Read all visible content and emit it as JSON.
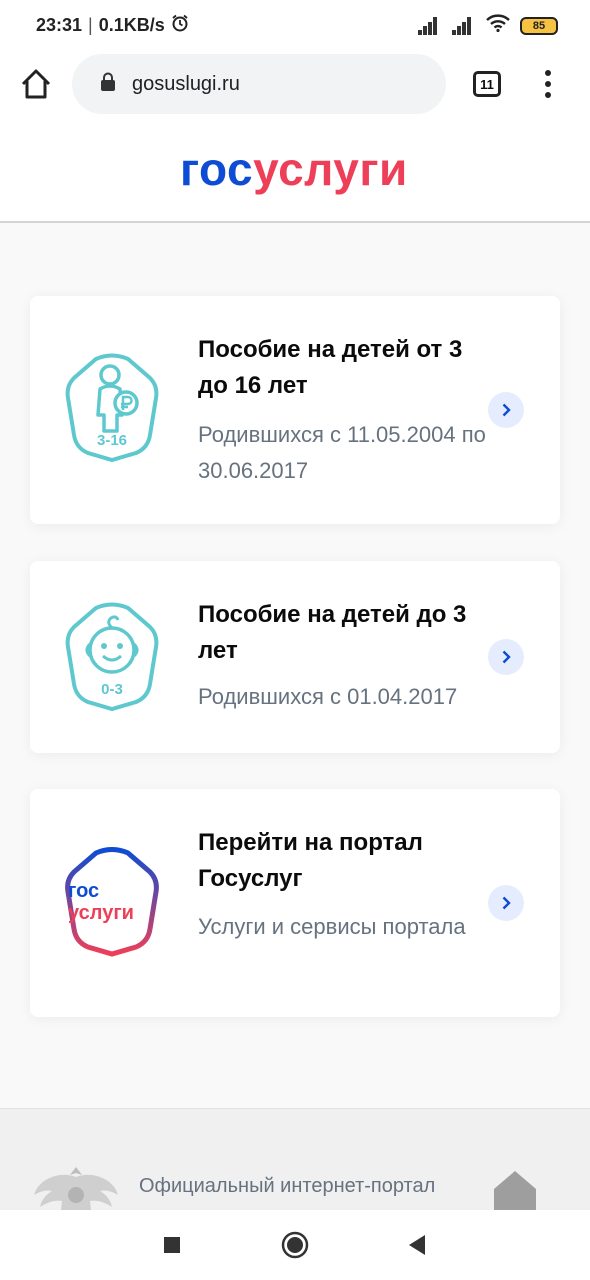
{
  "status": {
    "time": "23:31",
    "speed": "0.1KB/s",
    "battery": "85",
    "alarm_icon": "alarm-icon",
    "signal_icon": "signal-icon",
    "wifi_icon": "wifi-icon"
  },
  "browser": {
    "url": "gosuslugi.ru",
    "tab_count": "11",
    "icons": [
      "home-icon",
      "lock-icon",
      "tabs-icon",
      "more-vert-icon"
    ]
  },
  "header": {
    "logo_part1": "гос",
    "logo_part2": "услуги"
  },
  "cards": [
    {
      "title": "Пособие на детей от 3 до 16 лет",
      "desc": "Родившихся с 11.05.2004 по 30.06.2017",
      "icon_label": "3-16",
      "icon": "child-ruble-icon"
    },
    {
      "title": "Пособие на детей до 3 лет",
      "desc": "Родившихся с 01.04.2017",
      "icon_label": "0-3",
      "icon": "baby-face-icon"
    },
    {
      "title": "Перейти на портал Госуслуг",
      "desc": "Услуги и сервисы портала",
      "icon_label_1": "гос",
      "icon_label_2": "услуги",
      "icon": "gosuslugi-logo-icon"
    }
  ],
  "footer": {
    "text": "Официальный интернет-портал"
  },
  "colors": {
    "brand_blue": "#0d4cd3",
    "brand_red": "#ee3f58",
    "teal": "#5ec8cf",
    "arrow_bg": "#e4ecfd",
    "muted_text": "#66727f"
  }
}
